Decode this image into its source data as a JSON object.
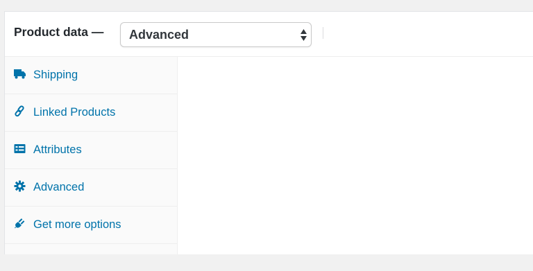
{
  "header": {
    "title": "Product data —",
    "select": {
      "value": "Advanced"
    }
  },
  "tabs": [
    {
      "label": "Shipping",
      "icon": "truck-icon"
    },
    {
      "label": "Linked Products",
      "icon": "link-icon"
    },
    {
      "label": "Attributes",
      "icon": "list-icon"
    },
    {
      "label": "Advanced",
      "icon": "gear-icon"
    },
    {
      "label": "Get more options",
      "icon": "plug-icon"
    }
  ],
  "colors": {
    "link": "#0073aa",
    "text": "#23282d",
    "sidebar_bg": "#fafafa",
    "page_bg": "#f1f1f1"
  }
}
